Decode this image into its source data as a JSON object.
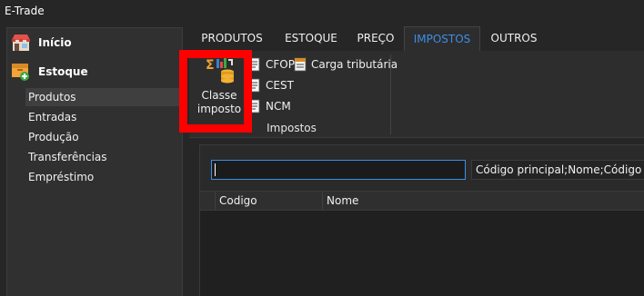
{
  "window": {
    "title": "E-Trade"
  },
  "sidebar": {
    "sections": [
      {
        "label": "Início",
        "icon": "store-icon"
      },
      {
        "label": "Estoque",
        "icon": "inventory-add-icon"
      }
    ],
    "items": [
      {
        "label": "Produtos",
        "selected": true
      },
      {
        "label": "Entradas",
        "selected": false
      },
      {
        "label": "Produção",
        "selected": false
      },
      {
        "label": "Transferências",
        "selected": false
      },
      {
        "label": "Empréstimo",
        "selected": false
      }
    ]
  },
  "tabs": [
    {
      "label": "PRODUTOS",
      "active": false
    },
    {
      "label": "ESTOQUE",
      "active": false
    },
    {
      "label": "PREÇO",
      "active": false
    },
    {
      "label": "IMPOSTOS",
      "active": true
    },
    {
      "label": "OUTROS",
      "active": false
    }
  ],
  "ribbon": {
    "big_button": {
      "label": "Classe\nimposto",
      "icon": "tax-class-icon"
    },
    "small_buttons": [
      {
        "label": "CFOP",
        "icon": "document-icon"
      },
      {
        "label": "Carga tributária",
        "icon": "tax-load-icon"
      },
      {
        "label": "CEST",
        "icon": "document-icon"
      },
      {
        "label": "NCM",
        "icon": "document-icon"
      }
    ],
    "group_label": "Impostos"
  },
  "search": {
    "value": "",
    "fields_label": "Código principal;Nome;Código fabr"
  },
  "grid": {
    "columns": [
      "Codigo",
      "Nome"
    ]
  },
  "colors": {
    "accent": "#3d8ee6",
    "highlight": "#ff0000",
    "background": "#1e1e1e"
  }
}
